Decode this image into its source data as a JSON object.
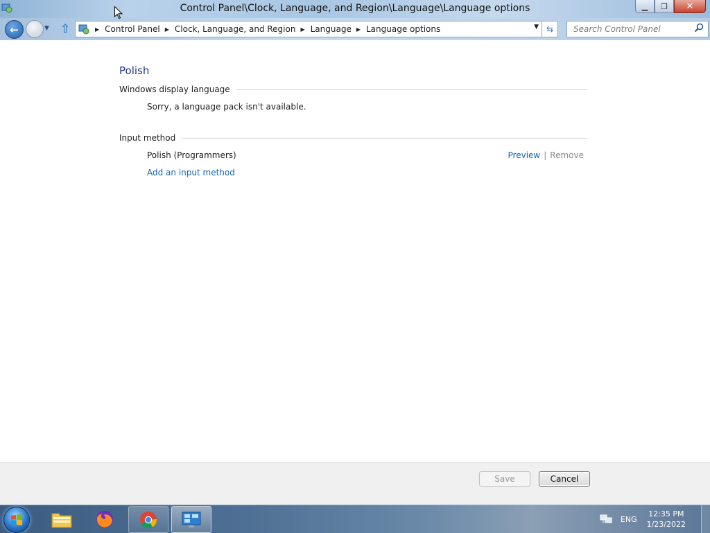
{
  "window": {
    "title": "Control Panel\\Clock, Language, and Region\\Language\\Language options",
    "controls": [
      "minimize",
      "restore",
      "close"
    ]
  },
  "navigation": {
    "breadcrumb": [
      "Control Panel",
      "Clock, Language, and Region",
      "Language",
      "Language options"
    ],
    "search_placeholder": "Search Control Panel"
  },
  "main": {
    "heading": "Polish",
    "display_language": {
      "label": "Windows display language",
      "message": "Sorry, a language pack isn't available."
    },
    "input_method": {
      "label": "Input method",
      "item": "Polish (Programmers)",
      "preview_link": "Preview",
      "separator": "|",
      "remove_link": "Remove",
      "add_link": "Add an input method"
    }
  },
  "footer": {
    "save_label": "Save",
    "cancel_label": "Cancel"
  },
  "taskbar": {
    "pinned": [
      "file-explorer-icon",
      "firefox-icon",
      "chrome-icon",
      "control-panel-icon"
    ],
    "language": "ENG",
    "time": "12:35 PM",
    "date": "1/23/2022"
  },
  "colors": {
    "link": "#1464b4",
    "heading": "#1e3287",
    "disabled": "#8c8c8c"
  }
}
